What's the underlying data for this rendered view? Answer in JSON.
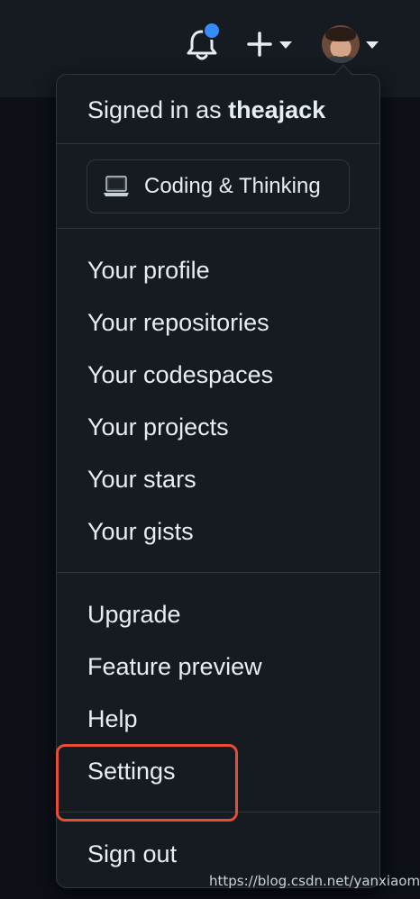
{
  "header": {
    "notifications_icon": "bell-icon",
    "notification_dot_color": "#388bfd",
    "create_icon": "plus-icon",
    "avatar_icon": "user-avatar"
  },
  "dropdown": {
    "signed_in_prefix": "Signed in as ",
    "username": "theajack",
    "status": {
      "emoji_icon": "laptop-icon",
      "text": "Coding & Thinking"
    },
    "group1": [
      {
        "label": "Your profile"
      },
      {
        "label": "Your repositories"
      },
      {
        "label": "Your codespaces"
      },
      {
        "label": "Your projects"
      },
      {
        "label": "Your stars"
      },
      {
        "label": "Your gists"
      }
    ],
    "group2": [
      {
        "label": "Upgrade"
      },
      {
        "label": "Feature preview"
      },
      {
        "label": "Help"
      },
      {
        "label": "Settings"
      }
    ],
    "sign_out": "Sign out"
  },
  "annotation": {
    "highlight_color": "#e74c35"
  },
  "watermark": "https://blog.csdn.net/yanxiaomu"
}
